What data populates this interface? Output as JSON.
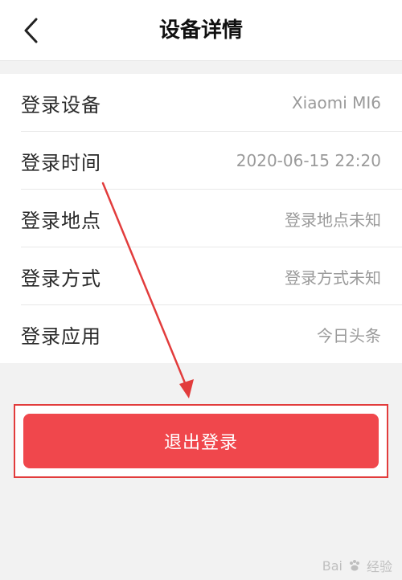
{
  "header": {
    "title": "设备详情"
  },
  "details": {
    "rows": [
      {
        "label": "登录设备",
        "value": "Xiaomi MI6"
      },
      {
        "label": "登录时间",
        "value": "2020-06-15 22:20"
      },
      {
        "label": "登录地点",
        "value": "登录地点未知"
      },
      {
        "label": "登录方式",
        "value": "登录方式未知"
      },
      {
        "label": "登录应用",
        "value": "今日头条"
      }
    ]
  },
  "actions": {
    "logout_label": "退出登录"
  },
  "watermark": {
    "brand": "Bai",
    "suffix": "经验"
  },
  "colors": {
    "accent": "#f0474c",
    "annotation": "#e23c3c"
  },
  "icons": {
    "back": "back-chevron-icon",
    "watermark": "paw-icon"
  }
}
